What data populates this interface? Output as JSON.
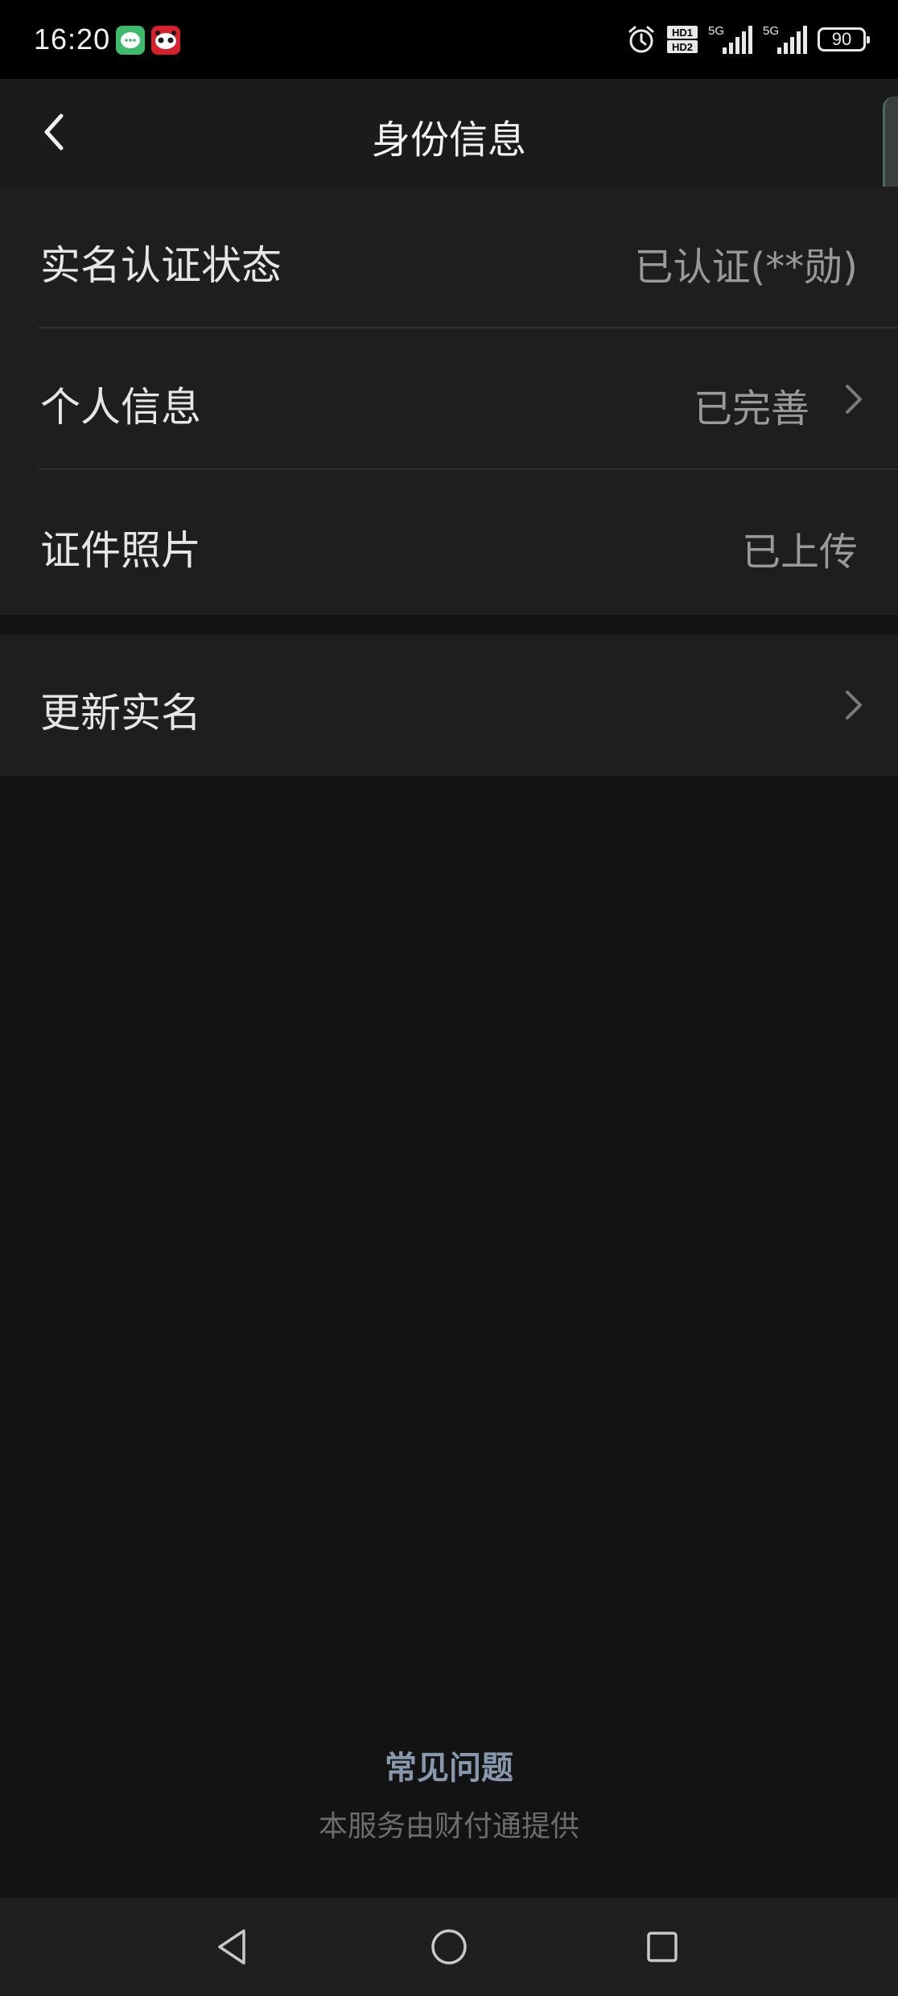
{
  "status_bar": {
    "time": "16:20",
    "network_1": "5G",
    "network_2": "5G",
    "hd_label_1": "HD1",
    "hd_label_2": "HD2",
    "battery": "90",
    "icons": [
      "message-app-icon",
      "panda-app-icon",
      "alarm-icon",
      "hd-icon",
      "signal-icon",
      "signal-icon",
      "battery-icon"
    ]
  },
  "header": {
    "title": "身份信息",
    "back_icon": "chevron-left-icon"
  },
  "info_list": [
    {
      "label": "实名认证状态",
      "value": "已认证(**勋)",
      "has_arrow": false
    },
    {
      "label": "个人信息",
      "value": "已完善",
      "has_arrow": true
    },
    {
      "label": "证件照片",
      "value": "已上传",
      "has_arrow": false
    }
  ],
  "update": {
    "label": "更新实名",
    "has_arrow": true
  },
  "footer": {
    "faq": "常见问题",
    "provider": "本服务由财付通提供"
  },
  "system_nav": {
    "back_icon": "triangle-back-icon",
    "home_icon": "circle-home-icon",
    "recent_icon": "square-recents-icon"
  },
  "colors": {
    "background": "#131313",
    "card": "#1e1e1e",
    "link": "#8898ac"
  }
}
